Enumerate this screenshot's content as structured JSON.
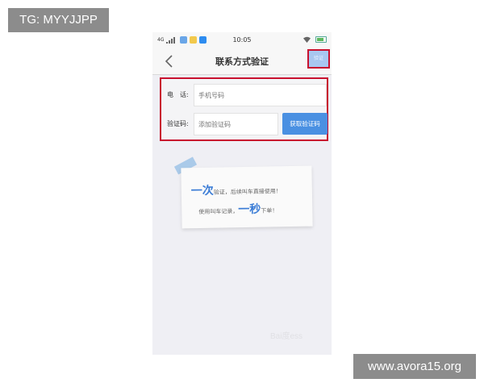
{
  "watermarks": {
    "top_left": "TG: MYYJJPP",
    "bottom_right": "www.avora15.org",
    "baidu": "Bai度ess"
  },
  "statusbar": {
    "time": "10:05",
    "network": "4G"
  },
  "navbar": {
    "title": "联系方式验证",
    "action_label": "验证"
  },
  "form": {
    "phone_label": "电　话:",
    "phone_placeholder": "手机号码",
    "code_label": "验证码:",
    "code_placeholder": "添加验证码",
    "get_code_button": "获取验证码"
  },
  "note": {
    "line1_em": "一次",
    "line1_rest": "验证，后续叫车直接使用！",
    "line2_pre": "使用叫车记录，",
    "line2_em": "一秒",
    "line2_post": "下单！"
  },
  "colors": {
    "accent": "#4a90e2",
    "highlight_border": "#c8102e",
    "background": "#efeff4"
  }
}
